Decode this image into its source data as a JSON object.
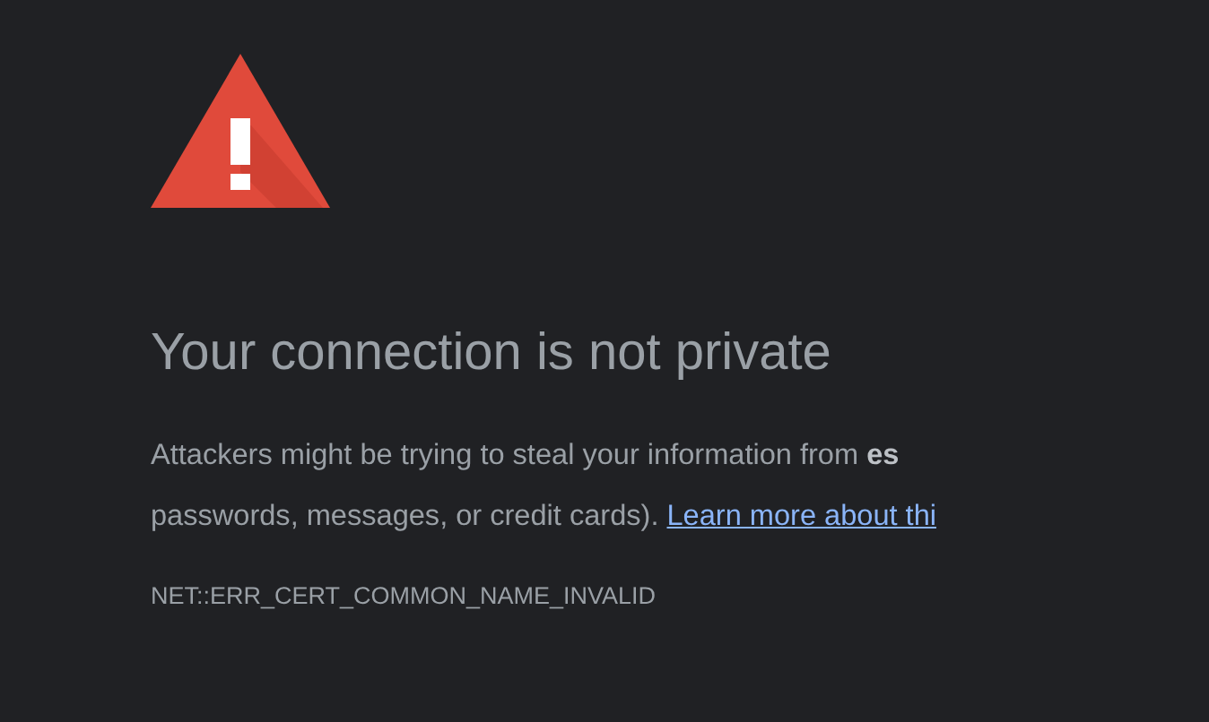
{
  "heading": "Your connection is not private",
  "paragraph": {
    "line_1": "Attackers might be trying to steal your information from **es**",
    "line_2": "passwords, messages, or credit cards). ",
    "link": "Learn more about thi"
  },
  "error_code": "NET::ERR_CERT_COMMON_NAME_INVALID"
}
